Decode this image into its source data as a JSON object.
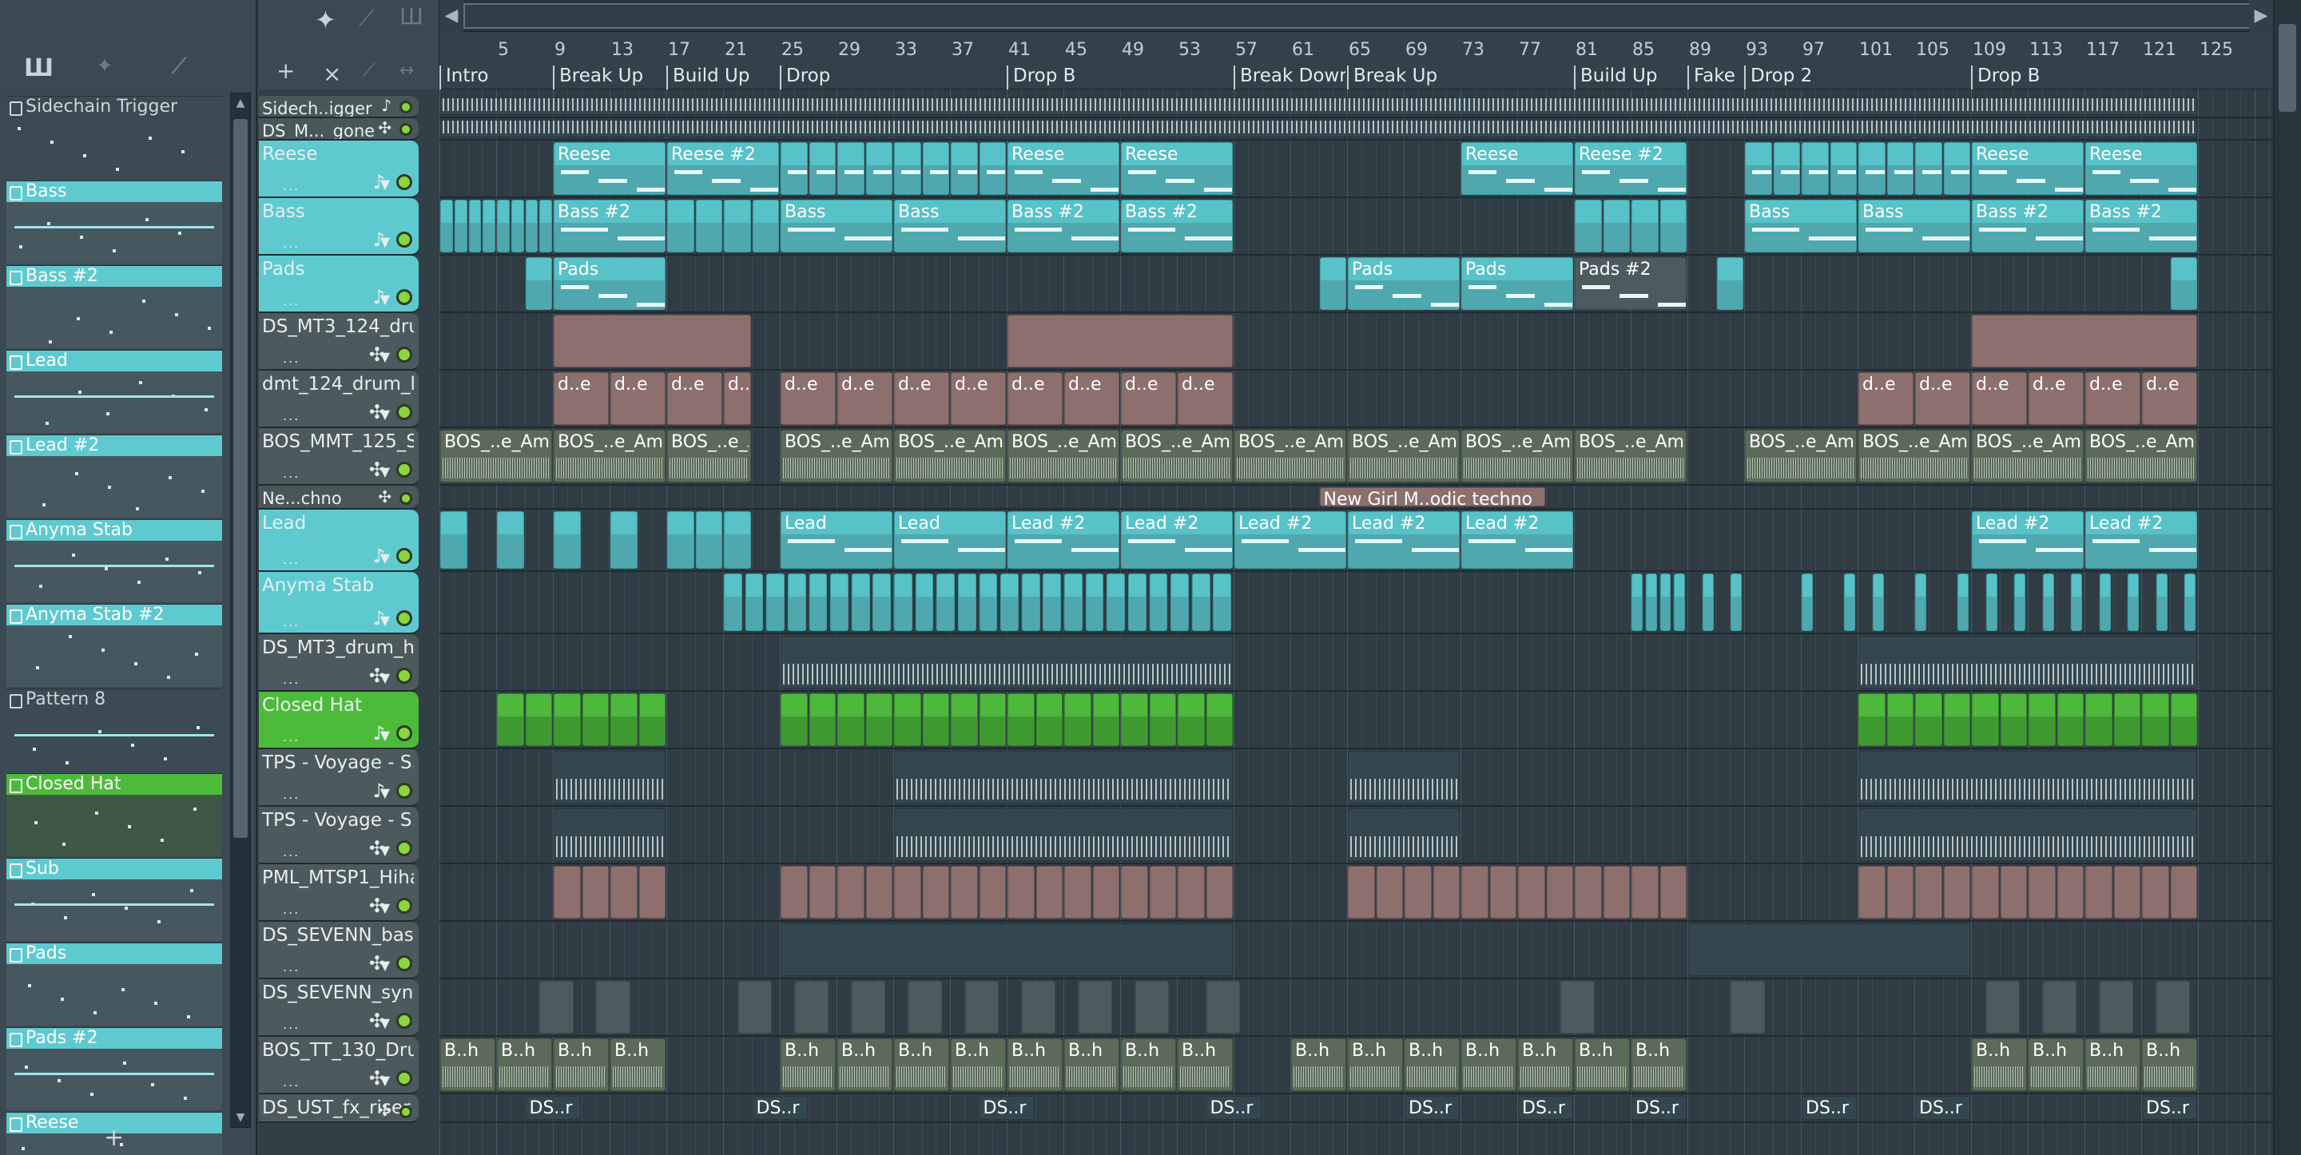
{
  "picker": {
    "patterns": [
      {
        "label": "Sidechain Trigger",
        "style": "plain"
      },
      {
        "label": "Bass",
        "style": "teal"
      },
      {
        "label": "Bass #2",
        "style": "teal"
      },
      {
        "label": "Lead",
        "style": "teal"
      },
      {
        "label": "Lead #2",
        "style": "teal"
      },
      {
        "label": "Anyma Stab",
        "style": "teal"
      },
      {
        "label": "Anyma Stab #2",
        "style": "teal"
      },
      {
        "label": "Pattern 8",
        "style": "plain"
      },
      {
        "label": "Closed Hat",
        "style": "green"
      },
      {
        "label": "Sub",
        "style": "teal"
      },
      {
        "label": "Pads",
        "style": "teal"
      },
      {
        "label": "Pads #2",
        "style": "teal"
      },
      {
        "label": "Reese",
        "style": "teal"
      }
    ],
    "add_label": "+"
  },
  "toolbar": {
    "add_label": "+",
    "delete_label": "×"
  },
  "ruler": {
    "bars": [
      "5",
      "9",
      "13",
      "17",
      "21",
      "25",
      "29",
      "33",
      "37",
      "41",
      "45",
      "49",
      "53",
      "57",
      "61",
      "65",
      "69",
      "73",
      "77",
      "81",
      "85",
      "89",
      "93",
      "97",
      "101",
      "105",
      "109",
      "113",
      "117",
      "121",
      "125"
    ],
    "markers": [
      {
        "label": "Intro",
        "bar": 1
      },
      {
        "label": "Break Up",
        "bar": 9
      },
      {
        "label": "Build Up",
        "bar": 17
      },
      {
        "label": "Drop",
        "bar": 25
      },
      {
        "label": "Drop B",
        "bar": 41
      },
      {
        "label": "Break Down",
        "bar": 57
      },
      {
        "label": "Break Up",
        "bar": 65
      },
      {
        "label": "Build Up",
        "bar": 81
      },
      {
        "label": "Fake D",
        "bar": 89
      },
      {
        "label": "Drop 2",
        "bar": 93
      },
      {
        "label": "Drop B",
        "bar": 109
      }
    ]
  },
  "tracks": [
    {
      "name": "Sidech..igger",
      "style": "small",
      "icon": "♪"
    },
    {
      "name": "DS_M..._gone",
      "style": "small",
      "icon": "✣"
    },
    {
      "name": "Reese",
      "style": "teal",
      "icon": "♪"
    },
    {
      "name": "Bass",
      "style": "teal",
      "icon": "♪"
    },
    {
      "name": "Pads",
      "style": "teal",
      "icon": "♪"
    },
    {
      "name": "DS_MT3_124_dru...",
      "style": "gray",
      "icon": "✣"
    },
    {
      "name": "dmt_124_drum_l...",
      "style": "gray",
      "icon": "✣"
    },
    {
      "name": "BOS_MMT_125_Sy...",
      "style": "gray",
      "icon": "✣"
    },
    {
      "name": "Ne...chno",
      "style": "small",
      "icon": "✣"
    },
    {
      "name": "Lead",
      "style": "teal",
      "icon": "♪"
    },
    {
      "name": "Anyma Stab",
      "style": "teal",
      "icon": "♪"
    },
    {
      "name": "DS_MT3_drum_h...",
      "style": "gray",
      "icon": "✣"
    },
    {
      "name": "Closed Hat",
      "style": "green",
      "icon": "♪"
    },
    {
      "name": "TPS - Voyage - S...",
      "style": "gray",
      "icon": "♪"
    },
    {
      "name": "TPS - Voyage - S...",
      "style": "gray",
      "icon": "✣"
    },
    {
      "name": "PML_MTSP1_Hiha...",
      "style": "gray",
      "icon": "✣"
    },
    {
      "name": "DS_SEVENN_bass...",
      "style": "gray",
      "icon": "✣"
    },
    {
      "name": "DS_SEVENN_synt...",
      "style": "gray",
      "icon": "✣"
    },
    {
      "name": "BOS_TT_130_Dru...",
      "style": "gray",
      "icon": "✣"
    },
    {
      "name": "DS_UST_fx_riser...",
      "style": "gray",
      "icon": "✣"
    }
  ],
  "clips": {
    "reese": [
      "Reese",
      "Reese #2",
      "Reese",
      "Reese",
      "Reese",
      "Reese #2",
      "Reese",
      "Reese"
    ],
    "bass": [
      "Bass #2",
      "Bass",
      "Bass",
      "Bass #2",
      "Bass #2",
      "Bass",
      "Bass",
      "Bass #2",
      "Bass #2"
    ],
    "pads": [
      "Pads",
      "Pads",
      "Pads",
      "Pads #2"
    ],
    "dmt": "d..e",
    "bos": "BOS_..e_Am",
    "newgirl": "New Girl M..odic techno",
    "lead": [
      "Lead",
      "Lead",
      "Lead #2",
      "Lead #2",
      "Lead #2",
      "Lead #2",
      "Lead #2",
      "Lead #2",
      "Lead #2"
    ],
    "bosd": "B..h",
    "ds": "DS..r"
  }
}
